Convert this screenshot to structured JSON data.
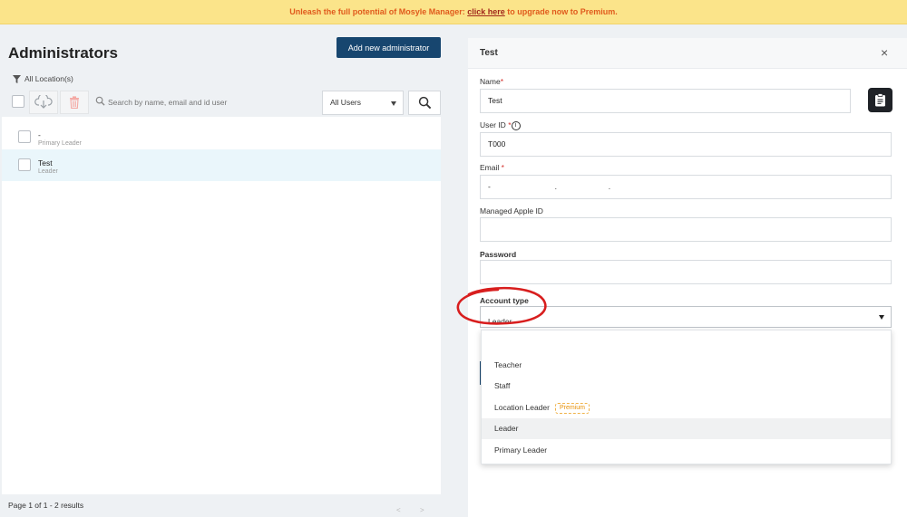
{
  "banner": {
    "prefix": "Unleash the full potential of Mosyle Manager: ",
    "link": "click here",
    "suffix": " to upgrade now to Premium."
  },
  "left": {
    "title": "Administrators",
    "add_button": "Add new administrator",
    "location_filter": "All Location(s)",
    "search_placeholder": "Search by name, email and id user",
    "user_filter": "All Users",
    "rows": [
      {
        "name": "-",
        "role": "Primary Leader"
      },
      {
        "name": "Test",
        "role": "Leader"
      }
    ],
    "footer": "Page 1 of 1 - 2 results",
    "pager_prev": "<",
    "pager_next": ">"
  },
  "detail": {
    "title": "Test",
    "close": "×",
    "name_label": "Name",
    "name_value": "Test",
    "userid_label": "User ID",
    "userid_value": "T000",
    "email_label": "Email",
    "email_value": "-                              .                        .",
    "apple_id_label": "Managed Apple ID",
    "apple_id_value": "",
    "password_label": "Password",
    "password_value": "",
    "account_type_label": "Account type",
    "account_type_value": "Leader",
    "required_mark": "*",
    "info_glyph": "i",
    "options": [
      {
        "label": "Teacher"
      },
      {
        "label": "Staff"
      },
      {
        "label": "Location Leader",
        "badge": "Premium"
      },
      {
        "label": "Leader"
      },
      {
        "label": "Primary Leader"
      }
    ]
  },
  "colors": {
    "banner_bg": "#fbe48a",
    "banner_text": "#e05a1c",
    "primary": "#17466f",
    "selected_row": "#eaf6fb",
    "premium": "#e8930c",
    "annotation": "#d81e1e"
  },
  "icons": [
    "filter-icon",
    "download-icon",
    "trash-icon",
    "search-icon",
    "caret-down-icon",
    "clipboard-icon",
    "info-icon",
    "close-icon"
  ]
}
